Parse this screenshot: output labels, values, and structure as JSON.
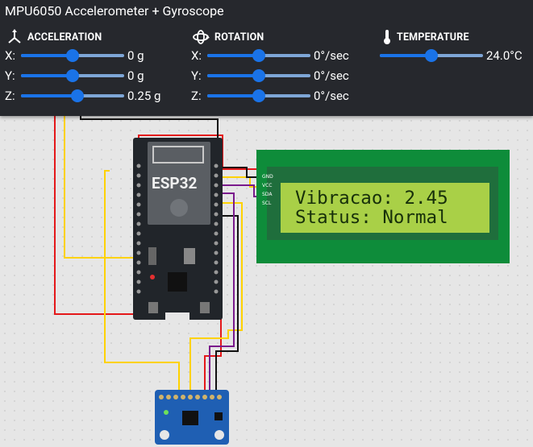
{
  "panel": {
    "title": "MPU6050 Accelerometer + Gyroscope",
    "acceleration": {
      "heading": "ACCELERATION",
      "icon": "axes-icon",
      "rows": [
        {
          "axis": "X:",
          "value": "0 g",
          "level": 0.5
        },
        {
          "axis": "Y:",
          "value": "0 g",
          "level": 0.5
        },
        {
          "axis": "Z:",
          "value": "0.25 g",
          "level": 0.55
        }
      ]
    },
    "rotation": {
      "heading": "ROTATION",
      "icon": "rotate-3d-icon",
      "rows": [
        {
          "axis": "X:",
          "value": "0°/sec",
          "level": 0.5
        },
        {
          "axis": "Y:",
          "value": "0°/sec",
          "level": 0.5
        },
        {
          "axis": "Z:",
          "value": "0°/sec",
          "level": 0.5
        }
      ]
    },
    "temperature": {
      "heading": "TEMPERATURE",
      "icon": "thermometer-icon",
      "value": "24.0°C",
      "level": 0.5
    }
  },
  "lcd": {
    "line1": "Vibracao: 2.45",
    "line2": "Status: Normal",
    "pins": [
      "GND",
      "VCC",
      "SDA",
      "SCL"
    ]
  },
  "esp32": {
    "label": "ESP32"
  },
  "colors": {
    "panel": "#26282d",
    "slider": "#1a73e8",
    "lcd_board": "#0e8c3a",
    "lcd_screen": "#a9d047",
    "wire_red": "#e4181a",
    "wire_yellow": "#ffd200",
    "wire_black": "#111111",
    "wire_purple": "#7a1a8c"
  }
}
